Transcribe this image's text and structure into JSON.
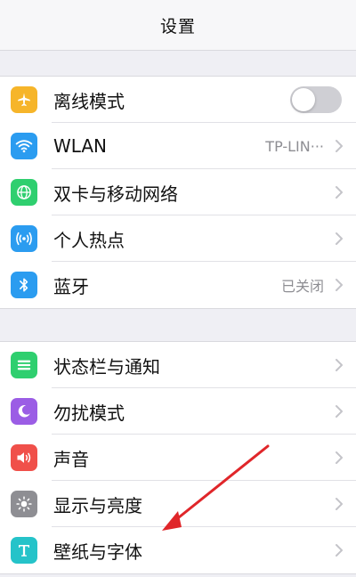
{
  "header": {
    "title": "设置"
  },
  "group1": [
    {
      "label": "离线模式",
      "icon": "airplane-icon",
      "color": "#f6b52a",
      "control": "toggle",
      "toggle_on": false
    },
    {
      "label": "WLAN",
      "icon": "wifi-icon",
      "color": "#2b9cf0",
      "value": "TP-LIN···"
    },
    {
      "label": "双卡与移动网络",
      "icon": "globe-icon",
      "color": "#2fcf6f"
    },
    {
      "label": "个人热点",
      "icon": "hotspot-icon",
      "color": "#2b9cf0"
    },
    {
      "label": "蓝牙",
      "icon": "bluetooth-icon",
      "color": "#2b9cf0",
      "value": "已关闭"
    }
  ],
  "group2": [
    {
      "label": "状态栏与通知",
      "icon": "notification-list-icon",
      "color": "#2fcf6f"
    },
    {
      "label": "勿扰模式",
      "icon": "moon-icon",
      "color": "#9b5de5"
    },
    {
      "label": "声音",
      "icon": "speaker-icon",
      "color": "#f0504a"
    },
    {
      "label": "显示与亮度",
      "icon": "brightness-icon",
      "color": "#8e8e93"
    },
    {
      "label": "壁纸与字体",
      "icon": "text-t-icon",
      "color": "#25c3c9"
    }
  ],
  "annotation": {
    "color": "#e0262a"
  }
}
